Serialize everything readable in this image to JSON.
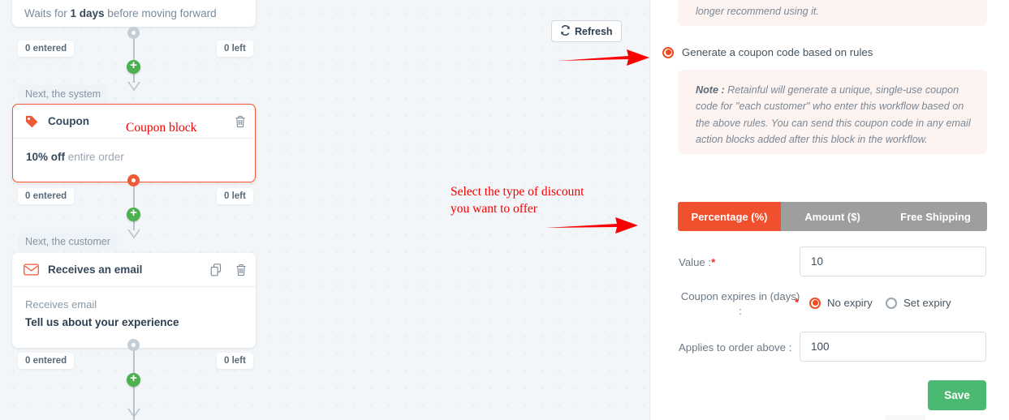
{
  "canvas": {
    "wait_block": {
      "prefix": "Waits for ",
      "value": "1 days",
      "suffix": " before moving forward"
    },
    "connector_labels": {
      "system": "Next, the system",
      "customer": "Next, the customer"
    },
    "stats": {
      "entered_1": "0 entered",
      "left_1": "0 left",
      "entered_2": "0 entered",
      "left_2": "0 left",
      "entered_3": "0 entered",
      "left_3": "0 left"
    },
    "coupon_card": {
      "icon": "tag-icon",
      "title": "Coupon",
      "body_strong": "10% off",
      "body_rest": " entire order",
      "delete_icon": "trash-icon"
    },
    "email_card": {
      "icon": "envelope-icon",
      "title": "Receives an email",
      "duplicate_icon": "duplicate-icon",
      "delete_icon": "trash-icon",
      "body_sub": "Receives email",
      "body_strong": "Tell us about your experience"
    },
    "refresh_button": {
      "icon": "refresh-icon",
      "label": "Refresh"
    },
    "annotations": {
      "coupon_block": "Coupon block",
      "select_discount": "Select the type of discount\nyou want to offer"
    }
  },
  "panel": {
    "top_note_fragment": "longer recommend using it.",
    "generate_option": {
      "label": "Generate a coupon code based on rules",
      "selected": true
    },
    "note": {
      "prefix": "Note :",
      "text": " Retainful will generate a unique, single-use coupon code for \"each customer\" who enter this workflow based on the above rules. You can send this coupon code in any email action blocks added after this block in the workflow."
    },
    "tabs": [
      {
        "label": "Percentage (%)",
        "active": true
      },
      {
        "label": "Amount ($)",
        "active": false
      },
      {
        "label": "Free Shipping",
        "active": false
      }
    ],
    "value_field": {
      "label": "Value :",
      "required": "*",
      "value": "10"
    },
    "expiry": {
      "label_line1": "Coupon expires in (days)",
      "label_line2": ":",
      "required": "*",
      "options": [
        {
          "label": "No expiry",
          "selected": true
        },
        {
          "label": "Set expiry",
          "selected": false
        }
      ]
    },
    "order_above": {
      "label": "Applies to order above :",
      "value": "100"
    },
    "save_button": {
      "label": "Save"
    }
  },
  "colors": {
    "accent_orange": "#f1502f",
    "radio_orange": "#ef4d20",
    "save_green": "#4cb972",
    "plus_green": "#4cb050",
    "annotation_red": "#f50000",
    "tab_inactive": "#9e9e9e",
    "canvas_bg": "#f2f6f9"
  }
}
